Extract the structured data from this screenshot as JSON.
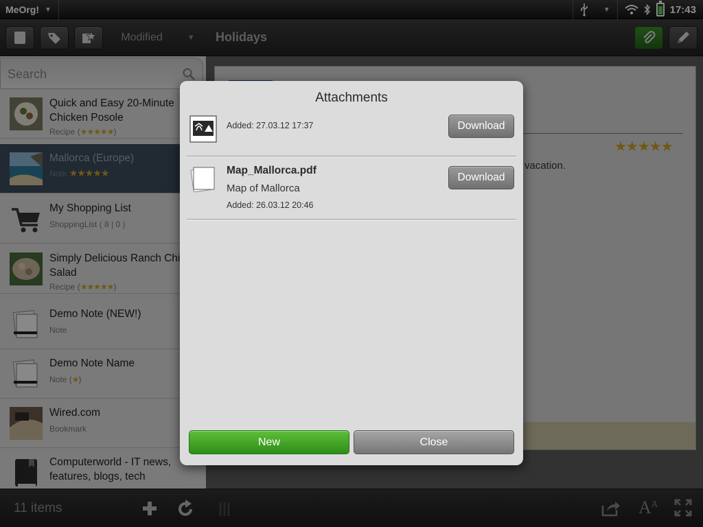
{
  "status_bar": {
    "app_name": "MeOrg!",
    "time": "17:43",
    "icons": [
      "usb-icon",
      "chevron-down-icon",
      "wifi-icon",
      "bluetooth-icon",
      "battery-icon"
    ]
  },
  "left_toolbar": {
    "buttons": [
      "notes-icon",
      "tag-icon",
      "favorites-icon"
    ],
    "sort_label": "Modified"
  },
  "search": {
    "placeholder": "Search"
  },
  "items": [
    {
      "title": "Quick and Easy 20-Minute Chicken Posole",
      "type": "Recipe",
      "rating": 5,
      "thumb": "food-photo"
    },
    {
      "title": "Mallorca (Europe)",
      "type": "Note",
      "rating": 5,
      "thumb": "beach-photo",
      "selected": true
    },
    {
      "title": "My Shopping List",
      "type": "ShoppingList ( 8 | 0 )",
      "thumb": "cart-icon"
    },
    {
      "title": "Simply Delicious Ranch Chicken Salad",
      "type": "Recipe",
      "rating": 5,
      "thumb": "food-photo"
    },
    {
      "title": "Demo Note (NEW!)",
      "type": "Note",
      "thumb": "note-pen-icon"
    },
    {
      "title": "Demo Note Name",
      "type": "Note",
      "rating": 1,
      "thumb": "note-pen-icon"
    },
    {
      "title": "Wired.com",
      "type": "Bookmark",
      "thumb": "bookmark-photo"
    },
    {
      "title": "Computerworld - IT news, features, blogs, tech",
      "type": "",
      "thumb": "book-icon"
    }
  ],
  "left_bottom": {
    "count_label": "11 items"
  },
  "note": {
    "title": "Holidays",
    "text_fragment": "vacation.",
    "rating": 5
  },
  "modal": {
    "title": "Attachments",
    "attachments": [
      {
        "name": "",
        "description": "",
        "added": "Added: 27.03.12 17:37",
        "download_label": "Download",
        "icon": "image-icon"
      },
      {
        "name": "Map_Mallorca.pdf",
        "description": "Map of Mallorca",
        "added": "Added: 26.03.12 20:46",
        "download_label": "Download",
        "icon": "document-icon"
      }
    ],
    "new_label": "New",
    "close_label": "Close"
  },
  "colors": {
    "accent_green": "#3a9a22",
    "selection": "#3d4b5e",
    "star": "#c9a227"
  }
}
